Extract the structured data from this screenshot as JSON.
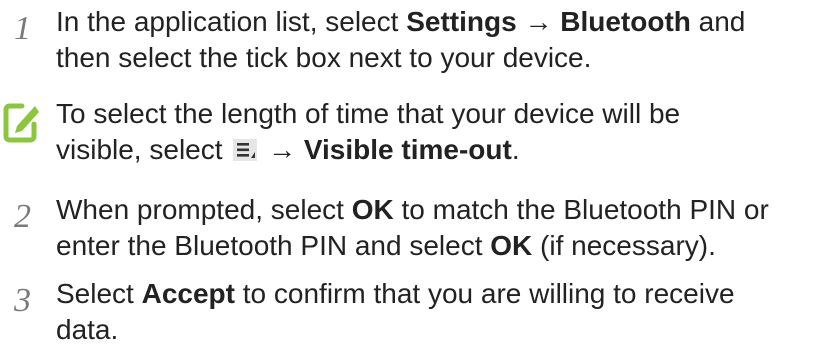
{
  "steps": [
    {
      "number": "1",
      "line1_pre": "In the application list, select ",
      "line1_b1": "Settings",
      "line1_arrow": " → ",
      "line1_b2": "Bluetooth",
      "line1_post": " and",
      "line2": "then select the tick box next to your device."
    },
    {
      "number": "2",
      "line1_pre": "When prompted, select ",
      "line1_b1": "OK",
      "line1_post": " to match the Bluetooth PIN or",
      "line2_pre": "enter the Bluetooth PIN and select ",
      "line2_b1": "OK",
      "line2_post": " (if necessary)."
    },
    {
      "number": "3",
      "line1_pre": "Select ",
      "line1_b1": "Accept",
      "line1_post": " to confirm that you are willing to receive",
      "line2": "data."
    }
  ],
  "note": {
    "icon": "note-pencil-icon",
    "line1": "To select the length of time that your device will be",
    "line2_pre": "visible, select ",
    "menu_icon": "menu-icon",
    "line2_arrow": " → ",
    "line2_b1": "Visible time-out",
    "line2_post": "."
  },
  "colors": {
    "note_icon": "#8cc63f",
    "step_number": "#7a7a7a",
    "text": "#222222"
  }
}
